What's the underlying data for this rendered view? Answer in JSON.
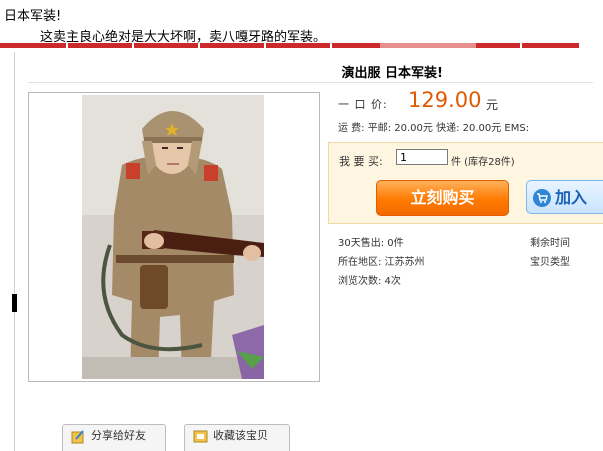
{
  "post": {
    "title": "日本军装!",
    "body": "这卖主良心绝对是大大坏啊，卖八嘎牙路的军装。"
  },
  "product": {
    "name": "演出服 日本军装!",
    "price_label": "一 口 价:",
    "price": "129.00",
    "price_unit": "元",
    "shipping": "运        费: 平邮: 20.00元 快递: 20.00元 EMS:"
  },
  "purchase": {
    "qty_label": "我 要 买:",
    "qty_value": "1",
    "stock_text": "件 (库存28件)",
    "buy_label": "立刻购买",
    "cart_label": "加入"
  },
  "stats": {
    "sold": "30天售出: 0件",
    "location": "所在地区: 江苏苏州",
    "views": "浏览次数: 4次",
    "remaining": "剩余时间",
    "item_type": "宝贝类型"
  },
  "actions": {
    "share_label": "分享给好友",
    "favorite_label": "收藏该宝贝"
  },
  "colors": {
    "price": "#e05a00",
    "buy_button": "#ff7a00",
    "strip": "#cc2a2a"
  }
}
